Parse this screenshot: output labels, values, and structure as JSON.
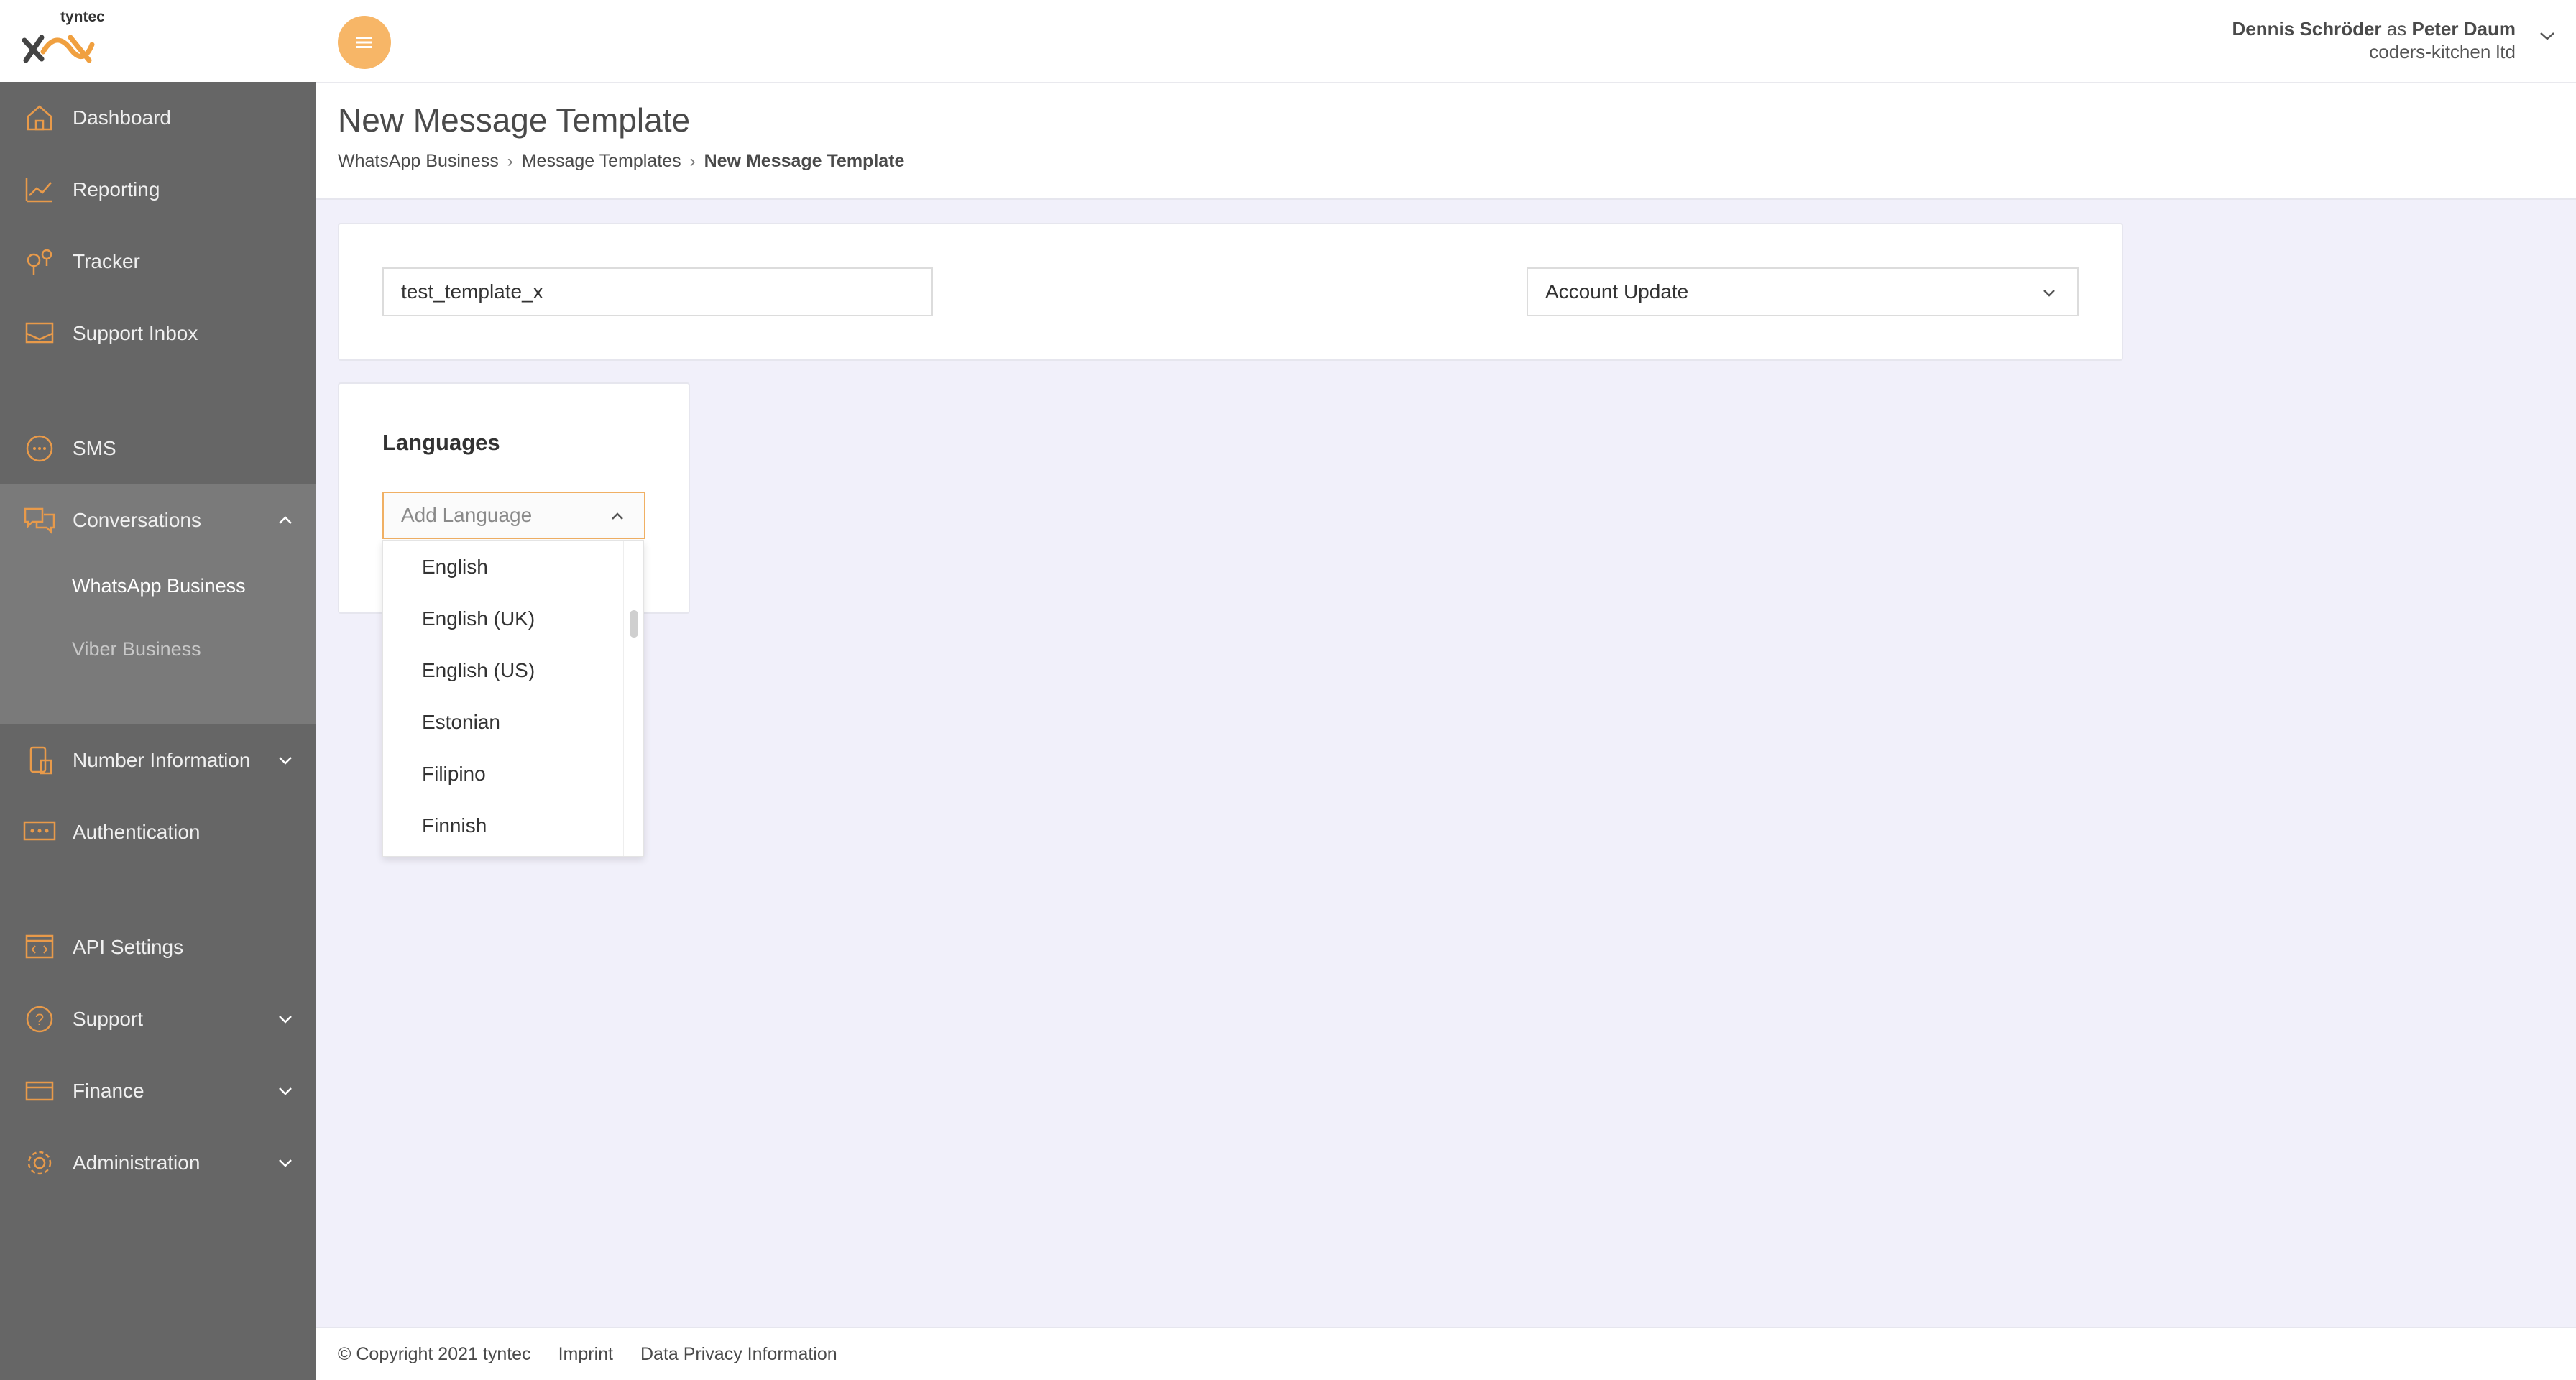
{
  "brand": {
    "name": "tyntec",
    "accent": "#f7b667",
    "sidebar_bg": "#666666"
  },
  "user": {
    "name": "Dennis Schröder",
    "as": "as",
    "impersonated": "Peter Daum",
    "company": "coders-kitchen ltd"
  },
  "sidebar": {
    "dashboard": "Dashboard",
    "reporting": "Reporting",
    "tracker": "Tracker",
    "support_inbox": "Support Inbox",
    "sms": "SMS",
    "conversations": "Conversations",
    "whatsapp_business": "WhatsApp Business",
    "viber_business": "Viber Business",
    "number_information": "Number Information",
    "authentication": "Authentication",
    "api_settings": "API Settings",
    "support": "Support",
    "finance": "Finance",
    "administration": "Administration"
  },
  "page": {
    "title": "New Message Template",
    "breadcrumb": [
      "WhatsApp Business",
      "Message Templates",
      "New Message Template"
    ]
  },
  "form": {
    "template_name_value": "test_template_x",
    "category_value": "Account Update",
    "languages_title": "Languages",
    "add_language_placeholder": "Add Language",
    "language_options": [
      "English",
      "English (UK)",
      "English (US)",
      "Estonian",
      "Filipino",
      "Finnish"
    ]
  },
  "footer": {
    "copyright": "© Copyright 2021 tyntec",
    "imprint": "Imprint",
    "privacy": "Data Privacy Information"
  }
}
